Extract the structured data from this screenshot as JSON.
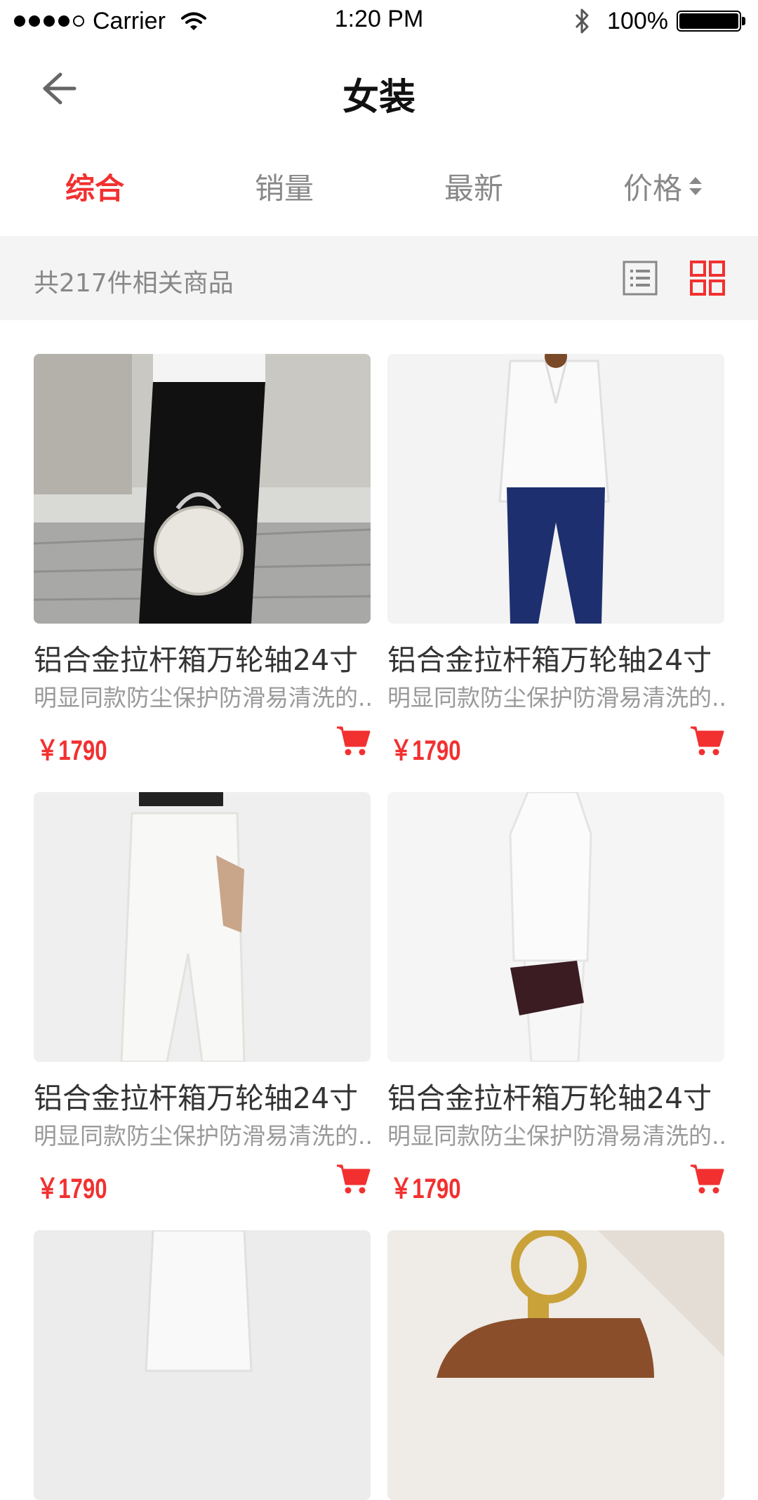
{
  "status_bar": {
    "carrier": "Carrier",
    "time": "1:20 PM",
    "battery": "100%"
  },
  "nav": {
    "title": "女装"
  },
  "tabs": [
    {
      "label": "综合",
      "active": true
    },
    {
      "label": "销量",
      "active": false
    },
    {
      "label": "最新",
      "active": false
    },
    {
      "label": "价格",
      "active": false
    }
  ],
  "info": {
    "count_text": "共217件相关商品"
  },
  "products": [
    {
      "title": "铝合金拉杆箱万轮轴24寸",
      "desc": "明显同款防尘保护防滑易清洗的..",
      "price": "￥1790"
    },
    {
      "title": "铝合金拉杆箱万轮轴24寸",
      "desc": "明显同款防尘保护防滑易清洗的..",
      "price": "￥1790"
    },
    {
      "title": "铝合金拉杆箱万轮轴24寸",
      "desc": "明显同款防尘保护防滑易清洗的..",
      "price": "￥1790"
    },
    {
      "title": "铝合金拉杆箱万轮轴24寸",
      "desc": "明显同款防尘保护防滑易清洗的..",
      "price": "￥1790"
    }
  ],
  "colors": {
    "accent": "#f23030",
    "muted_text": "#888888",
    "strip_bg": "#f4f4f4"
  },
  "icons": {
    "back": "arrow-left-icon",
    "list_view": "list-view-icon",
    "grid_view": "grid-view-icon",
    "cart": "cart-icon",
    "price_sort": "sort-updown-icon"
  }
}
